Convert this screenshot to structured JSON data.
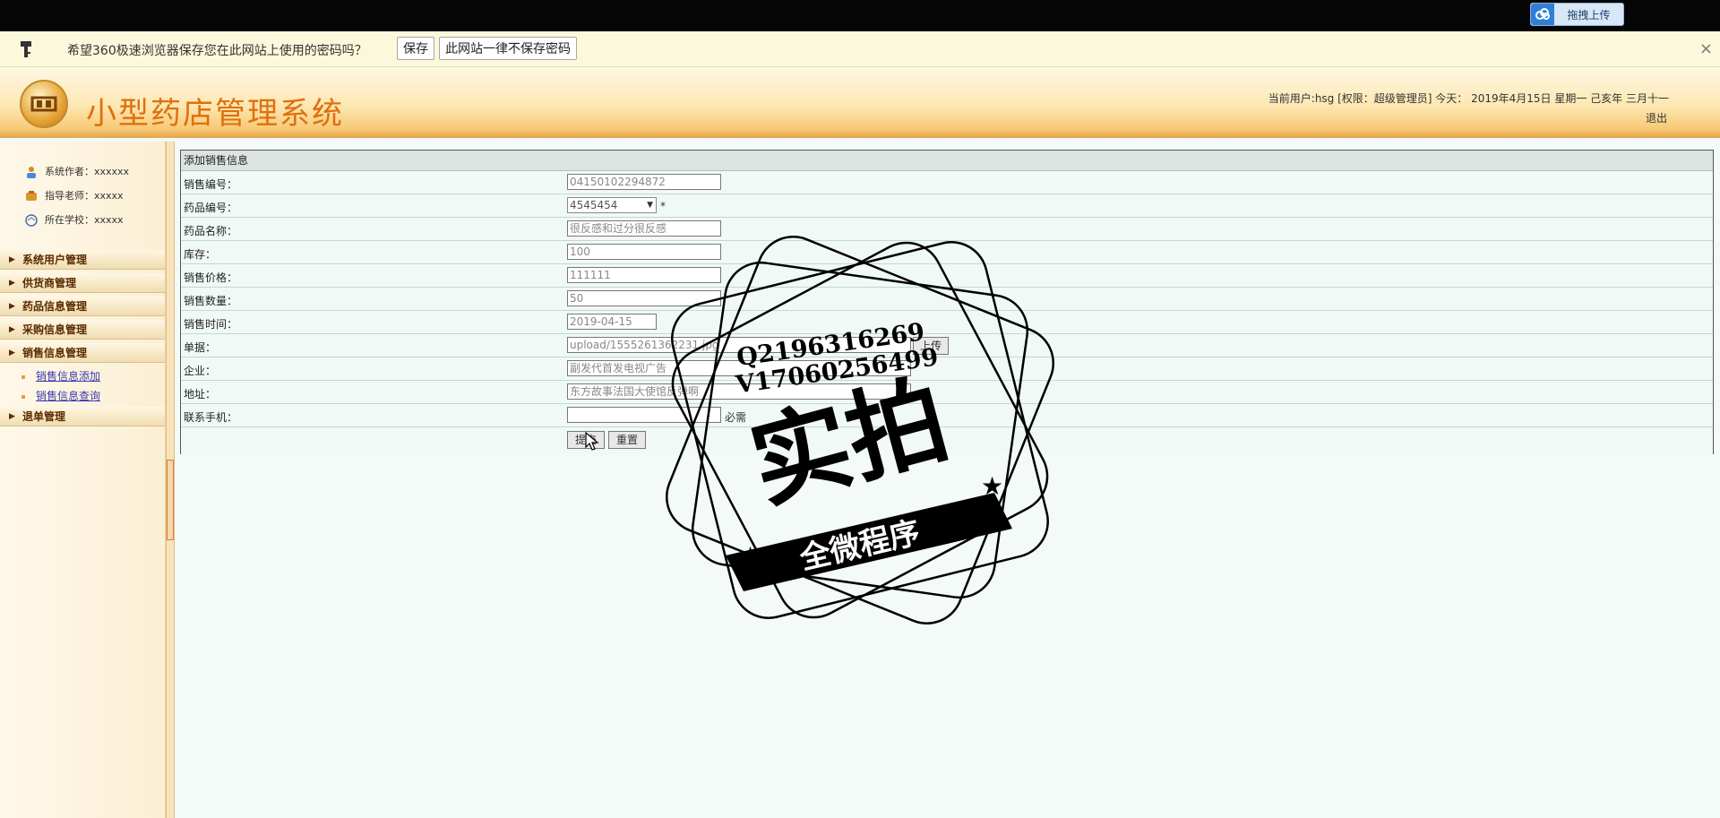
{
  "topbar": {
    "upload_label": "拖拽上传"
  },
  "password_bar": {
    "message": "希望360极速浏览器保存您在此网站上使用的密码吗？",
    "save_label": "保存",
    "never_label": "此网站一律不保存密码",
    "close_label": "×"
  },
  "header": {
    "title": "小型药店管理系统",
    "user_info": "当前用户:hsg [权限：超级管理员] 今天： 2019年4月15日 星期一 己亥年 三月十一",
    "logout_label": "退出"
  },
  "sidebar": {
    "info": [
      "系统作者：xxxxxx",
      "指导老师：xxxxx",
      "所在学校：xxxxx"
    ],
    "menus": [
      "系统用户管理",
      "供货商管理",
      "药品信息管理",
      "采购信息管理",
      "销售信息管理",
      "退单管理"
    ],
    "sub_items": [
      "销售信息添加",
      "销售信息查询"
    ]
  },
  "form": {
    "title": "添加销售信息",
    "fields": [
      {
        "label": "销售编号：",
        "value": "04150102294872"
      },
      {
        "label": "药品编号：",
        "value": "4545454",
        "required": "*"
      },
      {
        "label": "药品名称：",
        "value": "很反感和过分很反感"
      },
      {
        "label": "库存：",
        "value": "100"
      },
      {
        "label": "销售价格：",
        "value": "111111"
      },
      {
        "label": "销售数量：",
        "value": "50"
      },
      {
        "label": "销售时间：",
        "value": "2019-04-15"
      },
      {
        "label": "单据：",
        "value": "upload/1555261362231.jpg",
        "button": "上传"
      },
      {
        "label": "企业：",
        "value": "副发代首发电视广告"
      },
      {
        "label": "地址：",
        "value": "东方故事法国大使馆反弹啊"
      },
      {
        "label": "联系手机：",
        "value": "",
        "note": "必需"
      }
    ],
    "submit_label": "提交",
    "reset_label": "重置"
  },
  "watermark": {
    "line1": "Q2196316269",
    "line2": "V17060256499",
    "main": "实拍",
    "banner": "全微程序"
  }
}
